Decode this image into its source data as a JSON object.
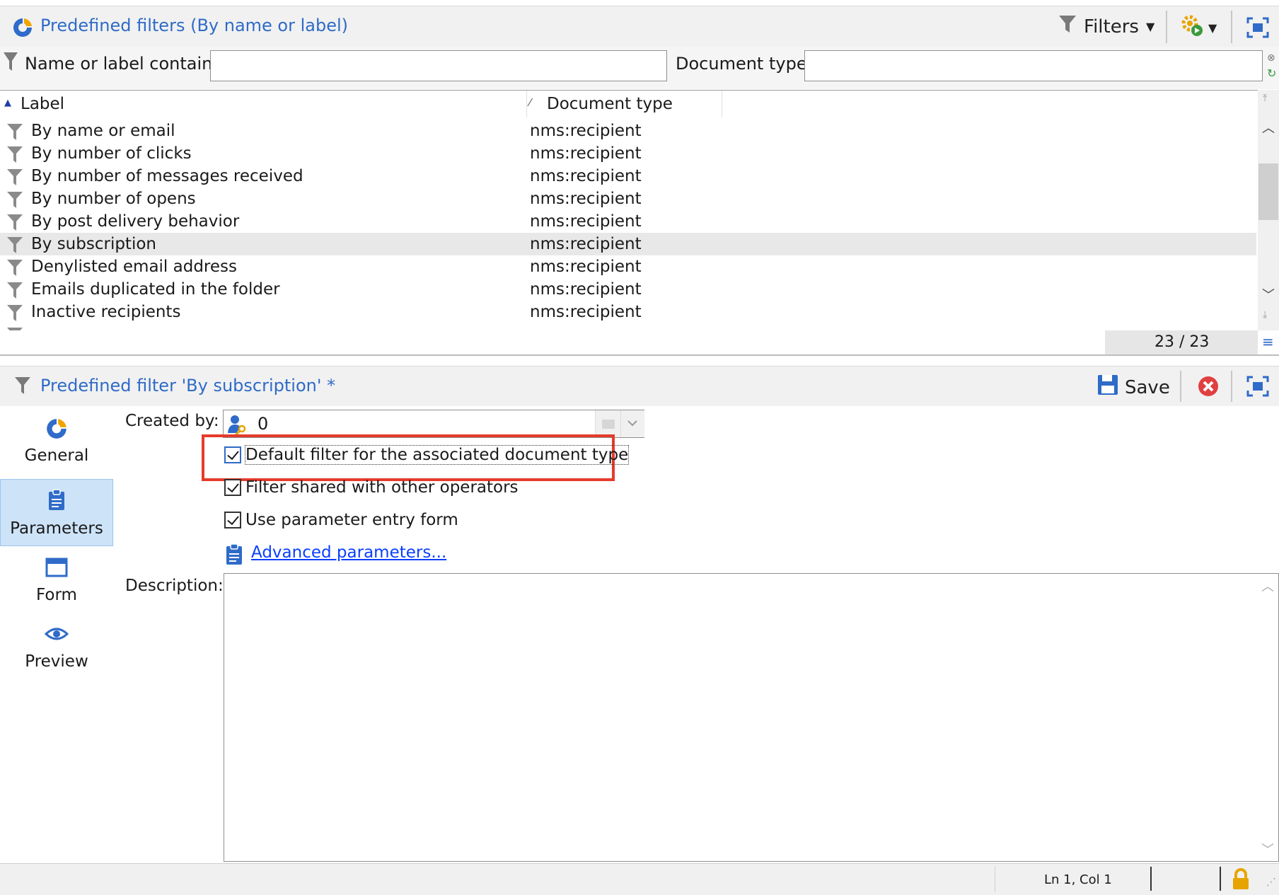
{
  "top_panel": {
    "title": "Predefined filters (By name or label)",
    "filters_label": "Filters"
  },
  "filter_bar": {
    "name_label": "Name or label contains:",
    "name_value": "",
    "doctype_label": "Document type:",
    "doctype_value": ""
  },
  "list": {
    "columns": [
      "Label",
      "Document type"
    ],
    "rows": [
      {
        "label": "By name or email",
        "doctype": "nms:recipient"
      },
      {
        "label": "By number of clicks",
        "doctype": "nms:recipient"
      },
      {
        "label": "By number of messages received",
        "doctype": "nms:recipient"
      },
      {
        "label": "By number of opens",
        "doctype": "nms:recipient"
      },
      {
        "label": "By post delivery behavior",
        "doctype": "nms:recipient"
      },
      {
        "label": "By subscription",
        "doctype": "nms:recipient"
      },
      {
        "label": "Denylisted email address",
        "doctype": "nms:recipient"
      },
      {
        "label": "Emails duplicated in the folder",
        "doctype": "nms:recipient"
      },
      {
        "label": "Inactive recipients",
        "doctype": "nms:recipient"
      }
    ],
    "selected_index": 5,
    "count": "23 / 23"
  },
  "detail": {
    "title": "Predefined filter 'By subscription' *",
    "save_label": "Save",
    "created_by_label": "Created by:",
    "created_by_value": "0",
    "options": [
      {
        "label": "Default filter for the associated document type",
        "checked": true
      },
      {
        "label": "Filter shared with other operators",
        "checked": true
      },
      {
        "label": "Use parameter entry form",
        "checked": true
      }
    ],
    "advanced_link": "Advanced parameters...",
    "description_label": "Description:",
    "description_value": ""
  },
  "nav": [
    {
      "label": "General",
      "icon": "general-icon"
    },
    {
      "label": "Parameters",
      "icon": "clipboard-icon",
      "active": true
    },
    {
      "label": "Form",
      "icon": "form-icon"
    },
    {
      "label": "Preview",
      "icon": "eye-icon"
    }
  ],
  "status": {
    "position": "Ln 1, Col 1"
  },
  "colors": {
    "accent": "#2f6bc8",
    "highlight_box": "#e53b2c",
    "nav_active": "#cde3f8",
    "link": "#0a3fff"
  }
}
